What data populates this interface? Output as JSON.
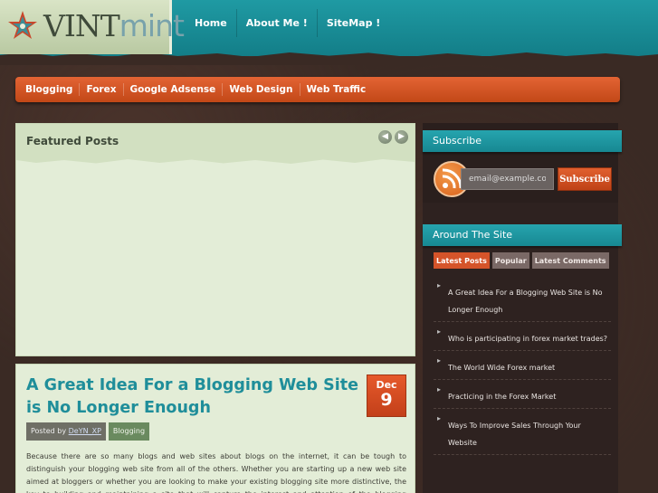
{
  "header": {
    "logo": {
      "part1": "VINT",
      "part2": "mint"
    },
    "nav": [
      "Home",
      "About Me !",
      "SiteMap !"
    ]
  },
  "categories": [
    "Blogging",
    "Forex",
    "Google Adsense",
    "Web Design",
    "Web Traffic"
  ],
  "featured": {
    "title": "Featured Posts",
    "prev_icon": "arrow-left-icon",
    "next_icon": "arrow-right-icon"
  },
  "post": {
    "title": "A Great Idea For a Blogging Web Site is No Longer Enough",
    "date": {
      "month": "Dec",
      "day": "9"
    },
    "posted_by_label": "Posted by",
    "author": "DeYN_XP",
    "category": "Blogging",
    "excerpt": "Because there are so many blogs and web sites about blogs on the internet, it can be tough to distinguish your blogging web site from all of the others. Whether you are starting up a new web site aimed at bloggers or whether you are looking to make your existing blogging site more distinctive, the key to building and maintaining a site that will capture the interest and attention of the blogging community is finding your niche. If"
  },
  "subscribe": {
    "title": "Subscribe",
    "email_placeholder": "email@example.com",
    "button": "Subscribe"
  },
  "around": {
    "title": "Around The Site",
    "tabs": [
      "Latest Posts",
      "Popular",
      "Latest Comments"
    ],
    "active_tab": 0,
    "posts": [
      "A Great Idea For a Blogging Web Site is No Longer Enough",
      "Who is participating in forex market trades?",
      "The World Wide Forex market",
      "Practicing in the Forex Market",
      "Ways To Improve Sales Through Your Website"
    ]
  },
  "colors": {
    "teal": "#1f9aa3",
    "orange": "#d5542a",
    "green_panel": "#e3edd7",
    "dark_brown": "#3a2a24"
  }
}
